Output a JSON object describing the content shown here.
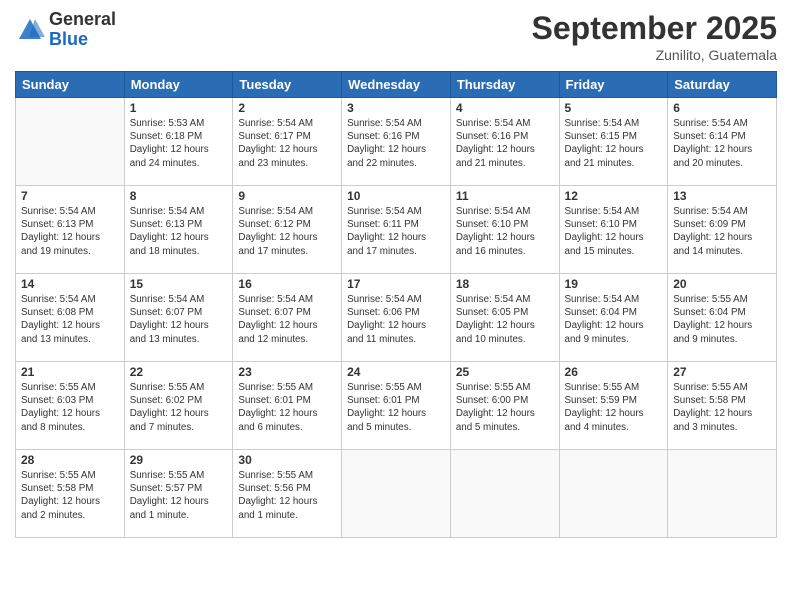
{
  "header": {
    "logo_general": "General",
    "logo_blue": "Blue",
    "month_title": "September 2025",
    "subtitle": "Zunilito, Guatemala"
  },
  "days_of_week": [
    "Sunday",
    "Monday",
    "Tuesday",
    "Wednesday",
    "Thursday",
    "Friday",
    "Saturday"
  ],
  "weeks": [
    [
      {
        "day": "",
        "info": ""
      },
      {
        "day": "1",
        "info": "Sunrise: 5:53 AM\nSunset: 6:18 PM\nDaylight: 12 hours\nand 24 minutes."
      },
      {
        "day": "2",
        "info": "Sunrise: 5:54 AM\nSunset: 6:17 PM\nDaylight: 12 hours\nand 23 minutes."
      },
      {
        "day": "3",
        "info": "Sunrise: 5:54 AM\nSunset: 6:16 PM\nDaylight: 12 hours\nand 22 minutes."
      },
      {
        "day": "4",
        "info": "Sunrise: 5:54 AM\nSunset: 6:16 PM\nDaylight: 12 hours\nand 21 minutes."
      },
      {
        "day": "5",
        "info": "Sunrise: 5:54 AM\nSunset: 6:15 PM\nDaylight: 12 hours\nand 21 minutes."
      },
      {
        "day": "6",
        "info": "Sunrise: 5:54 AM\nSunset: 6:14 PM\nDaylight: 12 hours\nand 20 minutes."
      }
    ],
    [
      {
        "day": "7",
        "info": "Sunrise: 5:54 AM\nSunset: 6:13 PM\nDaylight: 12 hours\nand 19 minutes."
      },
      {
        "day": "8",
        "info": "Sunrise: 5:54 AM\nSunset: 6:13 PM\nDaylight: 12 hours\nand 18 minutes."
      },
      {
        "day": "9",
        "info": "Sunrise: 5:54 AM\nSunset: 6:12 PM\nDaylight: 12 hours\nand 17 minutes."
      },
      {
        "day": "10",
        "info": "Sunrise: 5:54 AM\nSunset: 6:11 PM\nDaylight: 12 hours\nand 17 minutes."
      },
      {
        "day": "11",
        "info": "Sunrise: 5:54 AM\nSunset: 6:10 PM\nDaylight: 12 hours\nand 16 minutes."
      },
      {
        "day": "12",
        "info": "Sunrise: 5:54 AM\nSunset: 6:10 PM\nDaylight: 12 hours\nand 15 minutes."
      },
      {
        "day": "13",
        "info": "Sunrise: 5:54 AM\nSunset: 6:09 PM\nDaylight: 12 hours\nand 14 minutes."
      }
    ],
    [
      {
        "day": "14",
        "info": "Sunrise: 5:54 AM\nSunset: 6:08 PM\nDaylight: 12 hours\nand 13 minutes."
      },
      {
        "day": "15",
        "info": "Sunrise: 5:54 AM\nSunset: 6:07 PM\nDaylight: 12 hours\nand 13 minutes."
      },
      {
        "day": "16",
        "info": "Sunrise: 5:54 AM\nSunset: 6:07 PM\nDaylight: 12 hours\nand 12 minutes."
      },
      {
        "day": "17",
        "info": "Sunrise: 5:54 AM\nSunset: 6:06 PM\nDaylight: 12 hours\nand 11 minutes."
      },
      {
        "day": "18",
        "info": "Sunrise: 5:54 AM\nSunset: 6:05 PM\nDaylight: 12 hours\nand 10 minutes."
      },
      {
        "day": "19",
        "info": "Sunrise: 5:54 AM\nSunset: 6:04 PM\nDaylight: 12 hours\nand 9 minutes."
      },
      {
        "day": "20",
        "info": "Sunrise: 5:55 AM\nSunset: 6:04 PM\nDaylight: 12 hours\nand 9 minutes."
      }
    ],
    [
      {
        "day": "21",
        "info": "Sunrise: 5:55 AM\nSunset: 6:03 PM\nDaylight: 12 hours\nand 8 minutes."
      },
      {
        "day": "22",
        "info": "Sunrise: 5:55 AM\nSunset: 6:02 PM\nDaylight: 12 hours\nand 7 minutes."
      },
      {
        "day": "23",
        "info": "Sunrise: 5:55 AM\nSunset: 6:01 PM\nDaylight: 12 hours\nand 6 minutes."
      },
      {
        "day": "24",
        "info": "Sunrise: 5:55 AM\nSunset: 6:01 PM\nDaylight: 12 hours\nand 5 minutes."
      },
      {
        "day": "25",
        "info": "Sunrise: 5:55 AM\nSunset: 6:00 PM\nDaylight: 12 hours\nand 5 minutes."
      },
      {
        "day": "26",
        "info": "Sunrise: 5:55 AM\nSunset: 5:59 PM\nDaylight: 12 hours\nand 4 minutes."
      },
      {
        "day": "27",
        "info": "Sunrise: 5:55 AM\nSunset: 5:58 PM\nDaylight: 12 hours\nand 3 minutes."
      }
    ],
    [
      {
        "day": "28",
        "info": "Sunrise: 5:55 AM\nSunset: 5:58 PM\nDaylight: 12 hours\nand 2 minutes."
      },
      {
        "day": "29",
        "info": "Sunrise: 5:55 AM\nSunset: 5:57 PM\nDaylight: 12 hours\nand 1 minute."
      },
      {
        "day": "30",
        "info": "Sunrise: 5:55 AM\nSunset: 5:56 PM\nDaylight: 12 hours\nand 1 minute."
      },
      {
        "day": "",
        "info": ""
      },
      {
        "day": "",
        "info": ""
      },
      {
        "day": "",
        "info": ""
      },
      {
        "day": "",
        "info": ""
      }
    ]
  ]
}
